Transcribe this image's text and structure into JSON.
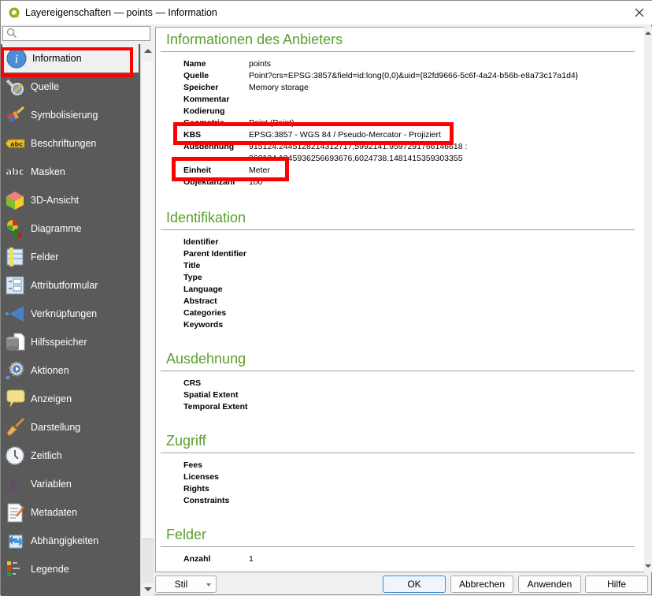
{
  "window": {
    "title": "Layereigenschaften — points — Information",
    "close_icon": "close-icon"
  },
  "sidebar": {
    "search_placeholder": "",
    "items": [
      {
        "label": "Information",
        "icon": "info-icon",
        "selected": true
      },
      {
        "label": "Quelle",
        "icon": "source-tools-icon"
      },
      {
        "label": "Symbolisierung",
        "icon": "symbology-brush-icon"
      },
      {
        "label": "Beschriftungen",
        "icon": "labels-abc-icon"
      },
      {
        "label": "Masken",
        "icon": "masks-abc-icon"
      },
      {
        "label": "3D-Ansicht",
        "icon": "cube-3d-icon"
      },
      {
        "label": "Diagramme",
        "icon": "diagrams-icon"
      },
      {
        "label": "Felder",
        "icon": "fields-icon"
      },
      {
        "label": "Attributformular",
        "icon": "attribute-form-icon"
      },
      {
        "label": "Verknüpfungen",
        "icon": "joins-icon"
      },
      {
        "label": "Hilfsspeicher",
        "icon": "auxiliary-storage-icon"
      },
      {
        "label": "Aktionen",
        "icon": "actions-gear-icon"
      },
      {
        "label": "Anzeigen",
        "icon": "display-speech-bubble-icon"
      },
      {
        "label": "Darstellung",
        "icon": "rendering-brush-icon"
      },
      {
        "label": "Zeitlich",
        "icon": "clock-icon"
      },
      {
        "label": "Variablen",
        "icon": "epsilon-icon"
      },
      {
        "label": "Metadaten",
        "icon": "metadata-notepad-icon"
      },
      {
        "label": "Abhängigkeiten",
        "icon": "dependencies-icon"
      },
      {
        "label": "Legende",
        "icon": "legend-icon"
      }
    ]
  },
  "content": {
    "provider": {
      "heading": "Informationen des Anbieters",
      "rows": [
        {
          "key": "Name",
          "value": "points"
        },
        {
          "key": "Quelle",
          "value": "Point?crs=EPSG:3857&field=id:long(0,0)&uid={82fd9666-5c6f-4a24-b56b-e8a73c17a1d4}"
        },
        {
          "key": "Speicher",
          "value": "Memory storage"
        },
        {
          "key": "Kommentar",
          "value": ""
        },
        {
          "key": "Kodierung",
          "value": ""
        },
        {
          "key": "Geometrie",
          "value": "Point (Point)"
        },
        {
          "key": "KBS",
          "value": "EPSG:3857 - WGS 84 / Pseudo-Mercator - Projiziert"
        },
        {
          "key": "Ausdehnung",
          "value": "915124.2445128214312717,5992141.9597291766146618 :\n962124.1245936256693676,6024738.1481415359303355"
        },
        {
          "key": "Einheit",
          "value": "Meter"
        },
        {
          "key": "Objektanzahl",
          "value": "100"
        }
      ]
    },
    "identification": {
      "heading": "Identifikation",
      "rows": [
        {
          "key": "Identifier",
          "value": ""
        },
        {
          "key": "Parent Identifier",
          "value": ""
        },
        {
          "key": "Title",
          "value": ""
        },
        {
          "key": "Type",
          "value": ""
        },
        {
          "key": "Language",
          "value": ""
        },
        {
          "key": "Abstract",
          "value": ""
        },
        {
          "key": "Categories",
          "value": ""
        },
        {
          "key": "Keywords",
          "value": ""
        }
      ]
    },
    "extent": {
      "heading": "Ausdehnung",
      "rows": [
        {
          "key": "CRS",
          "value": ""
        },
        {
          "key": "Spatial Extent",
          "value": ""
        },
        {
          "key": "Temporal Extent",
          "value": ""
        }
      ]
    },
    "access": {
      "heading": "Zugriff",
      "rows": [
        {
          "key": "Fees",
          "value": ""
        },
        {
          "key": "Licenses",
          "value": ""
        },
        {
          "key": "Rights",
          "value": ""
        },
        {
          "key": "Constraints",
          "value": ""
        }
      ]
    },
    "fields": {
      "heading": "Felder",
      "rows": [
        {
          "key": "Anzahl",
          "value": "1"
        }
      ]
    }
  },
  "footer": {
    "style_label": "Stil",
    "ok_label": "OK",
    "cancel_label": "Abbrechen",
    "apply_label": "Anwenden",
    "help_label": "Hilfe"
  },
  "colors": {
    "heading_green": "#5aa02c",
    "highlight_red": "#ff0000",
    "sidebar_bg": "#5a5a5a"
  }
}
